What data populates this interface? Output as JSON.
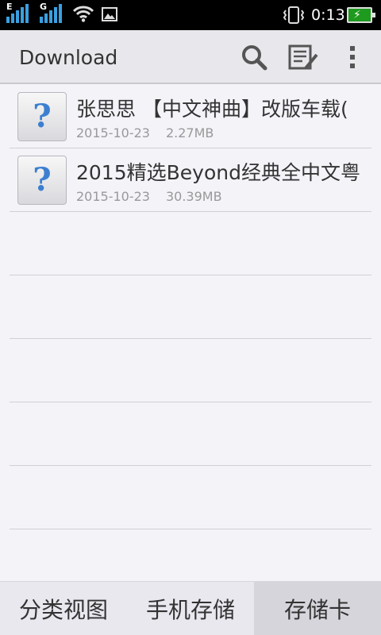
{
  "status_bar": {
    "signal1_label": "E",
    "signal2_label": "G",
    "time": "0:13",
    "icons": [
      "signal-icon",
      "signal-icon",
      "wifi-icon",
      "image-icon",
      "vibrate-icon",
      "battery-charging-icon"
    ]
  },
  "action_bar": {
    "title": "Download",
    "search_icon": "search-icon",
    "edit_icon": "edit-list-icon",
    "more_icon": "overflow-menu-icon"
  },
  "files": [
    {
      "name": "张思思 【中文神曲】改版车载(",
      "date": "2015-10-23",
      "size": "2.27MB",
      "icon": "unknown-file-icon"
    },
    {
      "name": "2015精选Beyond经典全中文粤",
      "date": "2015-10-23",
      "size": "30.39MB",
      "icon": "unknown-file-icon"
    }
  ],
  "tabs": [
    {
      "label": "分类视图",
      "active": false
    },
    {
      "label": "手机存储",
      "active": false
    },
    {
      "label": "存储卡",
      "active": true
    }
  ],
  "colors": {
    "accent": "#3aa0e0",
    "battery": "#1e9a1e",
    "file_icon": "#3c7fd0"
  }
}
